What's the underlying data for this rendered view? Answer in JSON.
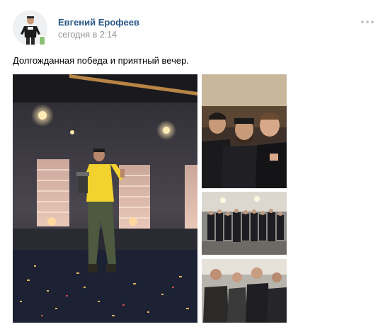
{
  "post": {
    "author_name": "Евгений Ерофеев",
    "timestamp": "сегодня в 2:14",
    "text": "Долгожданная победа и приятный вечер.",
    "online_status": "mobile-online",
    "more_icon": "more-horizontal-icon"
  },
  "colors": {
    "author": "#2a5885",
    "timestamp": "#939393",
    "online_indicator": "#8ac176"
  },
  "photos": [
    {
      "subject": "man on stage holding trophy"
    },
    {
      "subject": "three men selfie"
    },
    {
      "subject": "group photo"
    },
    {
      "subject": "group of friends"
    }
  ]
}
